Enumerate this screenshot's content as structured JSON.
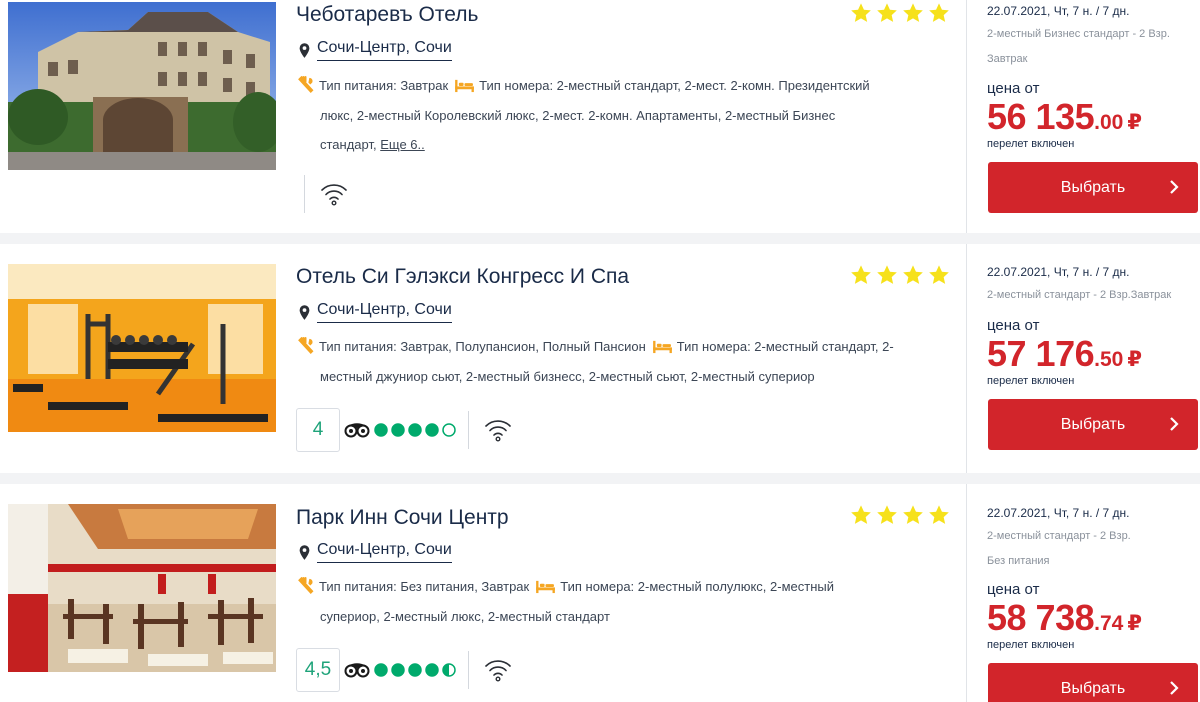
{
  "hotels": [
    {
      "name": "Чеботаревъ Отель",
      "stars": 4,
      "location": "Сочи-Центр, Сочи",
      "meal_label": "Тип питания: Завтрак",
      "room_label": "Тип номера: 2-местный стандарт, 2-мест. 2-комн. Президентский",
      "room_line2": "люкс, 2-местный Королевский люкс, 2-мест. 2-комн. Апартаменты, 2-местный Бизнес",
      "room_line3": "стандарт,",
      "more_link": "Еще 6..",
      "date": "22.07.2021, Чт, 7 н. / 7 дн.",
      "room_type": "2-местный Бизнес стандарт - 2 Взр.",
      "meal_short": "Завтрак",
      "price_from": "цена от",
      "price_main": "56 135",
      "price_cents": ".00",
      "currency": "₽",
      "flight": "перелет включен",
      "button": "Выбрать"
    },
    {
      "name": "Отель Си Гэлэкси Конгресс И Спа",
      "stars": 4,
      "location": "Сочи-Центр, Сочи",
      "meal_label": "Тип питания: Завтрак, Полупансион, Полный Пансион",
      "room_label": "Тип номера: 2-местный стандарт, 2-",
      "room_line2": "местный джуниор сьют, 2-местный бизнесс, 2-местный сьют, 2-местный супериор",
      "rating": "4",
      "rating_value": 4,
      "date": "22.07.2021, Чт, 7 н. / 7 дн.",
      "room_type": "2-местный стандарт - 2 Взр.Завтрак",
      "price_from": "цена от",
      "price_main": "57 176",
      "price_cents": ".50",
      "currency": "₽",
      "flight": "перелет включен",
      "button": "Выбрать"
    },
    {
      "name": "Парк Инн Сочи Центр",
      "stars": 4,
      "location": "Сочи-Центр, Сочи",
      "meal_label": "Тип питания: Без питания, Завтрак",
      "room_label": "Тип номера: 2-местный полулюкс, 2-местный",
      "room_line2": "супериор, 2-местный люкс, 2-местный стандарт",
      "rating": "4,5",
      "rating_value": 4.5,
      "date": "22.07.2021, Чт, 7 н. / 7 дн.",
      "room_type": "2-местный стандарт - 2 Взр.",
      "meal_short": "Без питания",
      "price_from": "цена от",
      "price_main": "58 738",
      "price_cents": ".74",
      "currency": "₽",
      "flight": "перелет включен",
      "button": "Выбрать"
    }
  ],
  "colors": {
    "accent_red": "#d2252b",
    "star_yellow": "#f6e11b",
    "tripadvisor_green": "#00aa6c",
    "meal_icon_orange": "#f5a623",
    "title_navy": "#1a2b48"
  },
  "icons": {
    "location": "location-pin-icon",
    "meal": "fork-knife-icon",
    "room": "bed-icon",
    "wifi": "wifi-icon",
    "tripadvisor": "tripadvisor-owl-icon",
    "chevron": "chevron-right-icon"
  }
}
